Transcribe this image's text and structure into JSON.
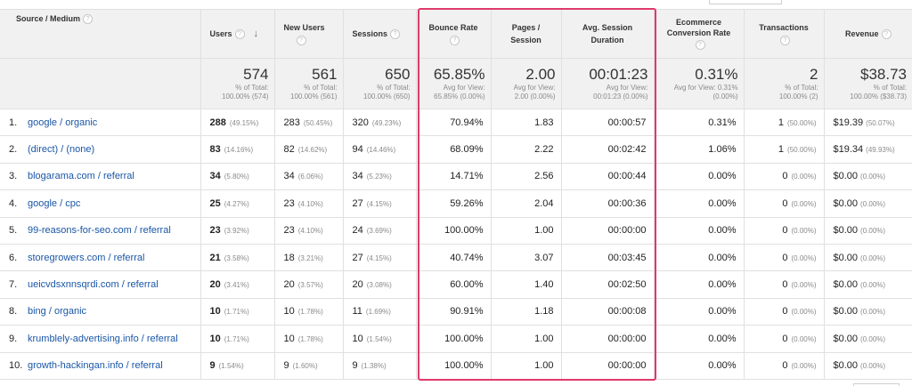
{
  "header": {
    "source_medium": "Source / Medium",
    "users": "Users",
    "new_users": "New Users",
    "sessions": "Sessions",
    "bounce_rate": "Bounce Rate",
    "pages_session": "Pages / Session",
    "avg_session_duration": "Avg. Session Duration",
    "ecommerce_conversion_rate": "Ecommerce Conversion Rate",
    "transactions": "Transactions",
    "revenue": "Revenue",
    "help_glyph": "?",
    "sort_glyph": "↓"
  },
  "totals": {
    "users": {
      "value": "574",
      "line1": "% of Total:",
      "line2": "100.00% (574)"
    },
    "new_users": {
      "value": "561",
      "line1": "% of Total:",
      "line2": "100.00% (561)"
    },
    "sessions": {
      "value": "650",
      "line1": "% of Total:",
      "line2": "100.00% (650)"
    },
    "bounce_rate": {
      "value": "65.85%",
      "line1": "Avg for View:",
      "line2": "65.85% (0.00%)"
    },
    "pages_session": {
      "value": "2.00",
      "line1": "Avg for View:",
      "line2": "2.00 (0.00%)"
    },
    "avg_session_duration": {
      "value": "00:01:23",
      "line1": "Avg for View:",
      "line2": "00:01:23 (0.00%)"
    },
    "ecommerce_conversion_rate": {
      "value": "0.31%",
      "line1": "Avg for View: 0.31%",
      "line2": "(0.00%)"
    },
    "transactions": {
      "value": "2",
      "line1": "% of Total:",
      "line2": "100.00% (2)"
    },
    "revenue": {
      "value": "$38.73",
      "line1": "% of Total:",
      "line2": "100.00% ($38.73)"
    }
  },
  "rows": [
    {
      "index": "1.",
      "source": "google / organic",
      "users": "288",
      "users_pct": "(49.15%)",
      "new_users": "283",
      "new_users_pct": "(50.45%)",
      "sessions": "320",
      "sessions_pct": "(49.23%)",
      "bounce_rate": "70.94%",
      "pages_session": "1.83",
      "duration": "00:00:57",
      "conv_rate": "0.31%",
      "transactions": "1",
      "transactions_pct": "(50.00%)",
      "revenue": "$19.39",
      "revenue_pct": "(50.07%)"
    },
    {
      "index": "2.",
      "source": "(direct) / (none)",
      "users": "83",
      "users_pct": "(14.16%)",
      "new_users": "82",
      "new_users_pct": "(14.62%)",
      "sessions": "94",
      "sessions_pct": "(14.46%)",
      "bounce_rate": "68.09%",
      "pages_session": "2.22",
      "duration": "00:02:42",
      "conv_rate": "1.06%",
      "transactions": "1",
      "transactions_pct": "(50.00%)",
      "revenue": "$19.34",
      "revenue_pct": "(49.93%)"
    },
    {
      "index": "3.",
      "source": "blogarama.com / referral",
      "users": "34",
      "users_pct": "(5.80%)",
      "new_users": "34",
      "new_users_pct": "(6.06%)",
      "sessions": "34",
      "sessions_pct": "(5.23%)",
      "bounce_rate": "14.71%",
      "pages_session": "2.56",
      "duration": "00:00:44",
      "conv_rate": "0.00%",
      "transactions": "0",
      "transactions_pct": "(0.00%)",
      "revenue": "$0.00",
      "revenue_pct": "(0.00%)"
    },
    {
      "index": "4.",
      "source": "google / cpc",
      "users": "25",
      "users_pct": "(4.27%)",
      "new_users": "23",
      "new_users_pct": "(4.10%)",
      "sessions": "27",
      "sessions_pct": "(4.15%)",
      "bounce_rate": "59.26%",
      "pages_session": "2.04",
      "duration": "00:00:36",
      "conv_rate": "0.00%",
      "transactions": "0",
      "transactions_pct": "(0.00%)",
      "revenue": "$0.00",
      "revenue_pct": "(0.00%)"
    },
    {
      "index": "5.",
      "source": "99-reasons-for-seo.com / referral",
      "users": "23",
      "users_pct": "(3.92%)",
      "new_users": "23",
      "new_users_pct": "(4.10%)",
      "sessions": "24",
      "sessions_pct": "(3.69%)",
      "bounce_rate": "100.00%",
      "pages_session": "1.00",
      "duration": "00:00:00",
      "conv_rate": "0.00%",
      "transactions": "0",
      "transactions_pct": "(0.00%)",
      "revenue": "$0.00",
      "revenue_pct": "(0.00%)"
    },
    {
      "index": "6.",
      "source": "storegrowers.com / referral",
      "users": "21",
      "users_pct": "(3.58%)",
      "new_users": "18",
      "new_users_pct": "(3.21%)",
      "sessions": "27",
      "sessions_pct": "(4.15%)",
      "bounce_rate": "40.74%",
      "pages_session": "3.07",
      "duration": "00:03:45",
      "conv_rate": "0.00%",
      "transactions": "0",
      "transactions_pct": "(0.00%)",
      "revenue": "$0.00",
      "revenue_pct": "(0.00%)"
    },
    {
      "index": "7.",
      "source": "ueicvdsxnnsqrdi.com / referral",
      "users": "20",
      "users_pct": "(3.41%)",
      "new_users": "20",
      "new_users_pct": "(3.57%)",
      "sessions": "20",
      "sessions_pct": "(3.08%)",
      "bounce_rate": "60.00%",
      "pages_session": "1.40",
      "duration": "00:02:50",
      "conv_rate": "0.00%",
      "transactions": "0",
      "transactions_pct": "(0.00%)",
      "revenue": "$0.00",
      "revenue_pct": "(0.00%)"
    },
    {
      "index": "8.",
      "source": "bing / organic",
      "users": "10",
      "users_pct": "(1.71%)",
      "new_users": "10",
      "new_users_pct": "(1.78%)",
      "sessions": "11",
      "sessions_pct": "(1.69%)",
      "bounce_rate": "90.91%",
      "pages_session": "1.18",
      "duration": "00:00:08",
      "conv_rate": "0.00%",
      "transactions": "0",
      "transactions_pct": "(0.00%)",
      "revenue": "$0.00",
      "revenue_pct": "(0.00%)"
    },
    {
      "index": "9.",
      "source": "krumblely-advertising.info / referral",
      "users": "10",
      "users_pct": "(1.71%)",
      "new_users": "10",
      "new_users_pct": "(1.78%)",
      "sessions": "10",
      "sessions_pct": "(1.54%)",
      "bounce_rate": "100.00%",
      "pages_session": "1.00",
      "duration": "00:00:00",
      "conv_rate": "0.00%",
      "transactions": "0",
      "transactions_pct": "(0.00%)",
      "revenue": "$0.00",
      "revenue_pct": "(0.00%)"
    },
    {
      "index": "10.",
      "source": "growth-hackingan.info / referral",
      "users": "9",
      "users_pct": "(1.54%)",
      "new_users": "9",
      "new_users_pct": "(1.60%)",
      "sessions": "9",
      "sessions_pct": "(1.38%)",
      "bounce_rate": "100.00%",
      "pages_session": "1.00",
      "duration": "00:00:00",
      "conv_rate": "0.00%",
      "transactions": "0",
      "transactions_pct": "(0.00%)",
      "revenue": "$0.00",
      "revenue_pct": "(0.00%)"
    }
  ],
  "colors": {
    "highlight_border": "#e03a6a",
    "link": "#1a56a6",
    "header_bg": "#f1f1f1"
  }
}
